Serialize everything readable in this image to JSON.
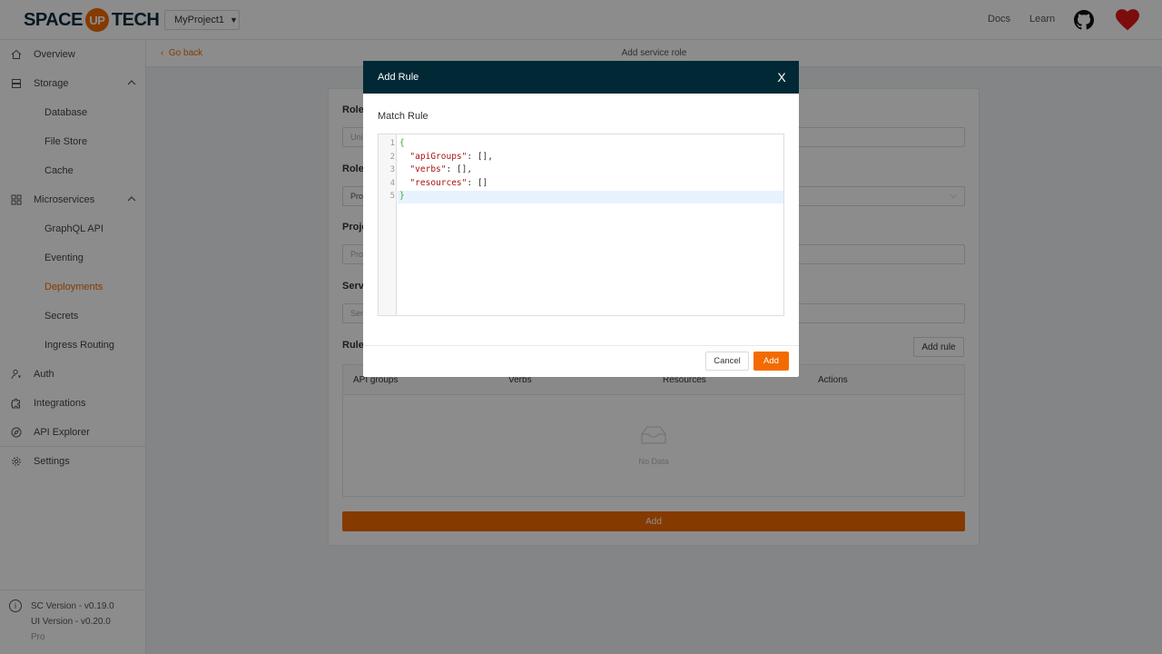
{
  "header": {
    "logo_left": "SPACE",
    "logo_mid": "UP",
    "logo_right": "TECH",
    "project": "MyProject1",
    "links": [
      "Docs",
      "Learn"
    ],
    "icons": [
      "github-icon",
      "heart-icon"
    ],
    "accent": "#f36b00"
  },
  "sidebar": {
    "items": [
      {
        "label": "Overview",
        "icon": "home-icon"
      },
      {
        "label": "Storage",
        "icon": "database-icon",
        "expanded": true
      },
      {
        "label": "Database"
      },
      {
        "label": "File Store"
      },
      {
        "label": "Cache"
      },
      {
        "label": "Microservices",
        "icon": "apps-icon",
        "expanded": true
      },
      {
        "label": "GraphQL API"
      },
      {
        "label": "Eventing"
      },
      {
        "label": "Deployments",
        "active": true
      },
      {
        "label": "Secrets"
      },
      {
        "label": "Ingress Routing"
      },
      {
        "label": "Auth",
        "icon": "user-key-icon"
      },
      {
        "label": "Integrations",
        "icon": "puzzle-icon"
      },
      {
        "label": "API Explorer",
        "icon": "compass-icon"
      },
      {
        "label": "Settings",
        "icon": "gear-icon"
      }
    ],
    "sc_version": "SC Version - v0.19.0",
    "ui_version": "UI Version - v0.20.0",
    "plan": "Pro"
  },
  "subheader": {
    "back": "Go back",
    "title": "Add service role"
  },
  "form": {
    "role_label": "Role",
    "role_placeholder": "Uni",
    "role_type_label": "Role",
    "role_type_value": "Proj",
    "project_label": "Proje",
    "project_placeholder": "Pro",
    "service_label": "Servi",
    "service_placeholder": "Ser",
    "rules_label": "Rules",
    "add_rule": "Add rule",
    "columns": [
      "API groups",
      "Verbs",
      "Resources",
      "Actions"
    ],
    "empty": "No Data",
    "submit": "Add"
  },
  "modal": {
    "title": "Add Rule",
    "close": "X",
    "match_label": "Match Rule",
    "code": {
      "line_numbers": [
        "1",
        "2",
        "3",
        "4",
        "5"
      ],
      "l1": "{",
      "l2_key": "\"apiGroups\"",
      "l2_rest": ": [],",
      "l3_key": "\"verbs\"",
      "l3_rest": ": [],",
      "l4_key": "\"resources\"",
      "l4_rest": ": []",
      "l5": "}"
    },
    "cancel": "Cancel",
    "add": "Add"
  }
}
